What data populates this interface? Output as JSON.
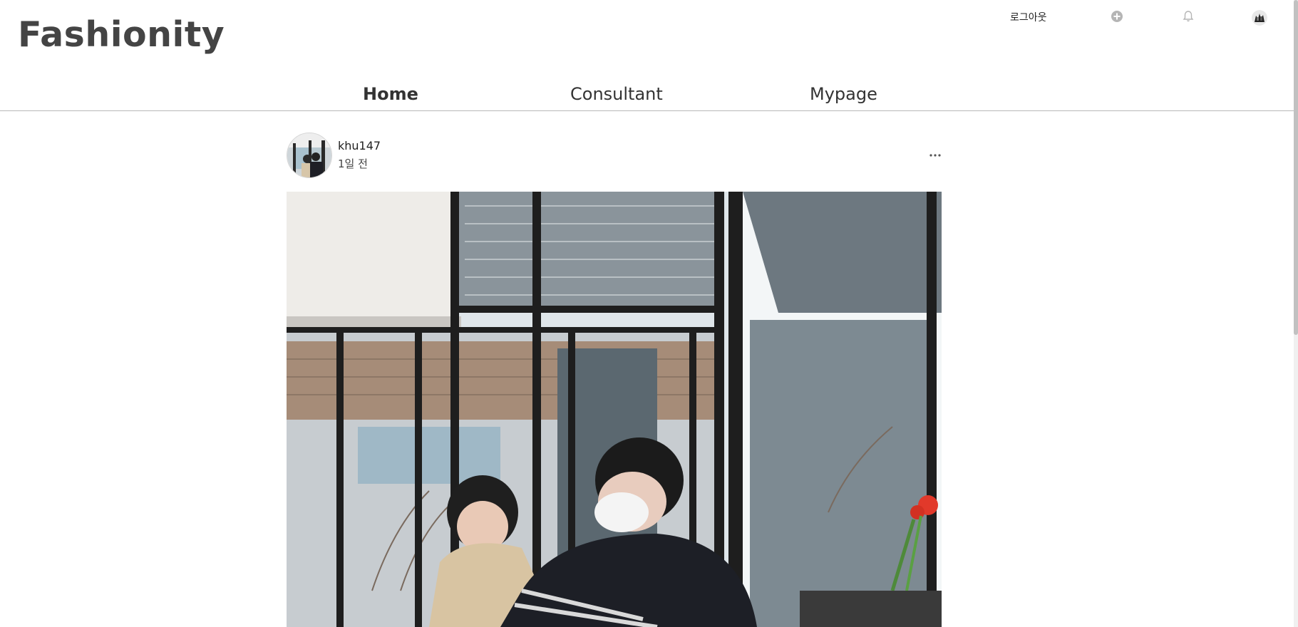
{
  "app": {
    "logo": "Fashionity"
  },
  "header": {
    "logout_label": "로그아웃",
    "icons": {
      "add": "plus-circle-icon",
      "notifications": "bell-icon",
      "profile": "avatar"
    }
  },
  "nav": {
    "items": [
      {
        "label": "Home",
        "active": true
      },
      {
        "label": "Consultant",
        "active": false
      },
      {
        "label": "Mypage",
        "active": false
      }
    ]
  },
  "post": {
    "username": "khu147",
    "time": "1일 전",
    "more_icon": "ellipsis-icon",
    "image_subject": "post-photo"
  },
  "colors": {
    "text": "#333333",
    "divider": "#b8b8b8",
    "icon_gray": "#b0b0b0"
  }
}
